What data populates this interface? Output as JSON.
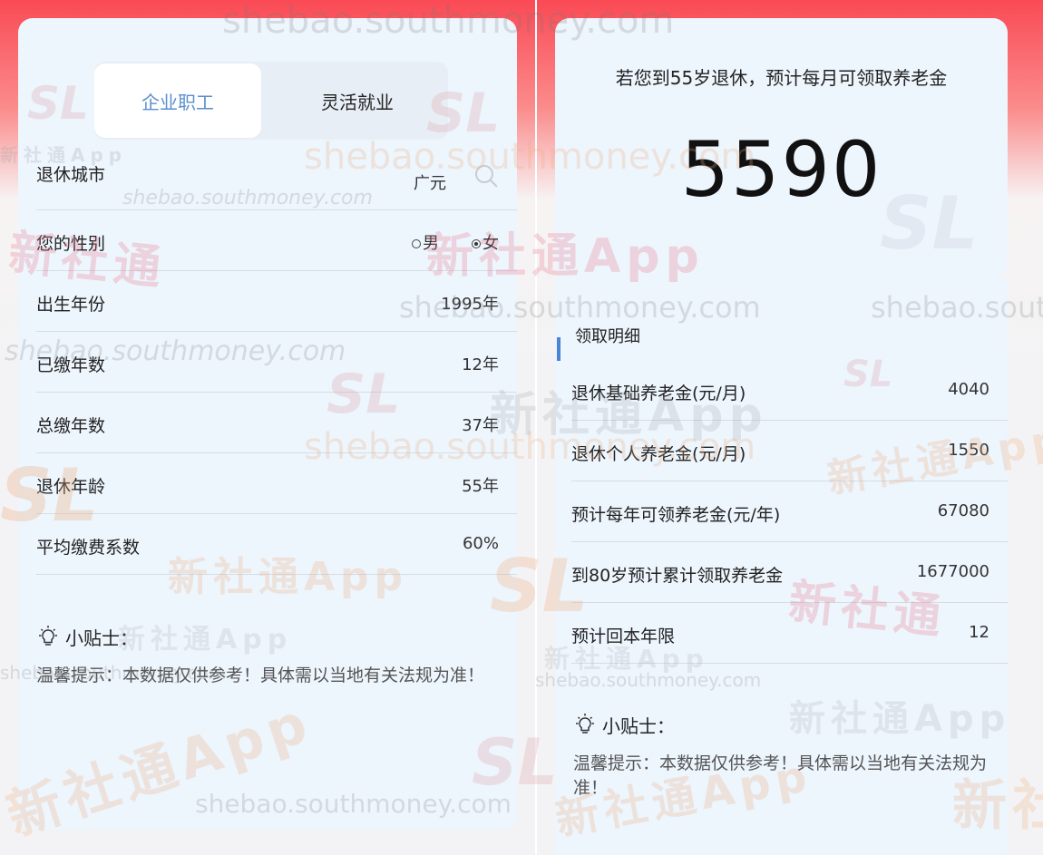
{
  "left": {
    "tabs": [
      {
        "label": "企业职工",
        "active": true
      },
      {
        "label": "灵活就业",
        "active": false
      }
    ],
    "form": {
      "city": {
        "label": "退休城市",
        "value": "广元"
      },
      "gender": {
        "label": "您的性别",
        "options": [
          "男",
          "女"
        ],
        "selected": "女"
      },
      "birth_year": {
        "label": "出生年份",
        "value": "1995年"
      },
      "paid_years": {
        "label": "已缴年数",
        "value": "12年"
      },
      "total_years": {
        "label": "总缴年数",
        "value": "37年"
      },
      "retire_age": {
        "label": "退休年龄",
        "value": "55年"
      },
      "avg_coeff": {
        "label": "平均缴费系数",
        "value": "60%"
      }
    },
    "tips": {
      "title": "小贴士：",
      "text": "温馨提示：本数据仅供参考！具体需以当地有关法规为准！"
    }
  },
  "right": {
    "headline": "若您到55岁退休，预计每月可领取养老金",
    "monthly_pension": "5590",
    "detail_title": "领取明细",
    "details": [
      {
        "label": "退休基础养老金(元/月)",
        "value": "4040"
      },
      {
        "label": "退休个人养老金(元/月)",
        "value": "1550"
      },
      {
        "label": "预计每年可领养老金(元/年)",
        "value": "67080"
      },
      {
        "label": "到80岁预计累计领取养老金",
        "value": "1677000"
      },
      {
        "label": "预计回本年限",
        "value": "12"
      }
    ],
    "tips": {
      "title": "小贴士：",
      "text": "温馨提示：本数据仅供参考！具体需以当地有关法规为准！"
    }
  },
  "watermarks": {
    "url": "shebao.southmoney.com",
    "app": "新社通App",
    "app_short": "新社通",
    "logo": "SL"
  },
  "colors": {
    "accent": "#5b8fd0",
    "header_red": "#fa4a55",
    "card_bg": "#edf5fd"
  }
}
